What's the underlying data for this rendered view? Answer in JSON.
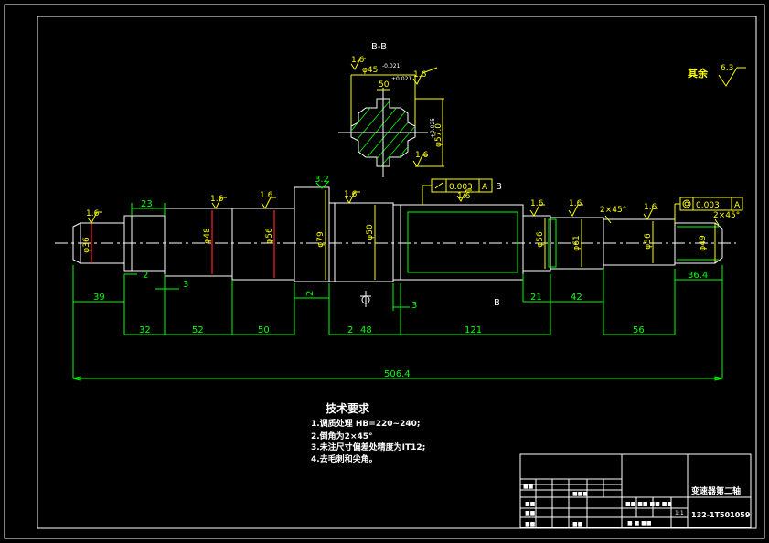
{
  "section_label": "B-B",
  "section_marks": [
    "B",
    "B"
  ],
  "roughness_other": {
    "label": "其余",
    "value": "6.3"
  },
  "roughness": [
    "1.6",
    "1.6",
    "1.6",
    "1.6",
    "1.6",
    "1.6",
    "1.6",
    "1.6",
    "1.6",
    "1.6",
    "1.6",
    "1.6"
  ],
  "section_dims": {
    "dia": "φ45",
    "dia_tol": "-0.021",
    "width": "50",
    "width_tol": "+0.021",
    "height": "φ57.0",
    "height_tol": "+0.025"
  },
  "diameters": [
    "φ36",
    "φ48",
    "φ56",
    "φ79",
    "φ50",
    "φ56",
    "φ61",
    "φ56",
    "φ49"
  ],
  "top_dims": {
    "a": "23",
    "b": "3.2"
  },
  "chamfer_labels": [
    "2×45°",
    "2×45°"
  ],
  "tolerance_frames": [
    {
      "symbol": "runout",
      "value": "0.003",
      "datum": "A"
    },
    {
      "symbol": "circle",
      "value": "0.003",
      "datum": "A"
    }
  ],
  "datum_label": "B",
  "bottom_dims": {
    "row1": [
      "39",
      "2",
      "3",
      "3",
      "21",
      "42",
      "36.4"
    ],
    "row2": [
      "32",
      "52",
      "50",
      "2",
      "48",
      "121",
      "56"
    ],
    "total": "506.4"
  },
  "tech_notes": {
    "title": "技术要求",
    "lines": [
      "1.调质处理 HB=220~240;",
      "2.倒角为2×45°",
      "3.未注尺寸偏差处精度为IT12;",
      "4.去毛刺和尖角。"
    ]
  },
  "title_block": {
    "part_name": "变速器第二轴",
    "drawing_no": "132-1T501059",
    "scale": "1:1"
  }
}
